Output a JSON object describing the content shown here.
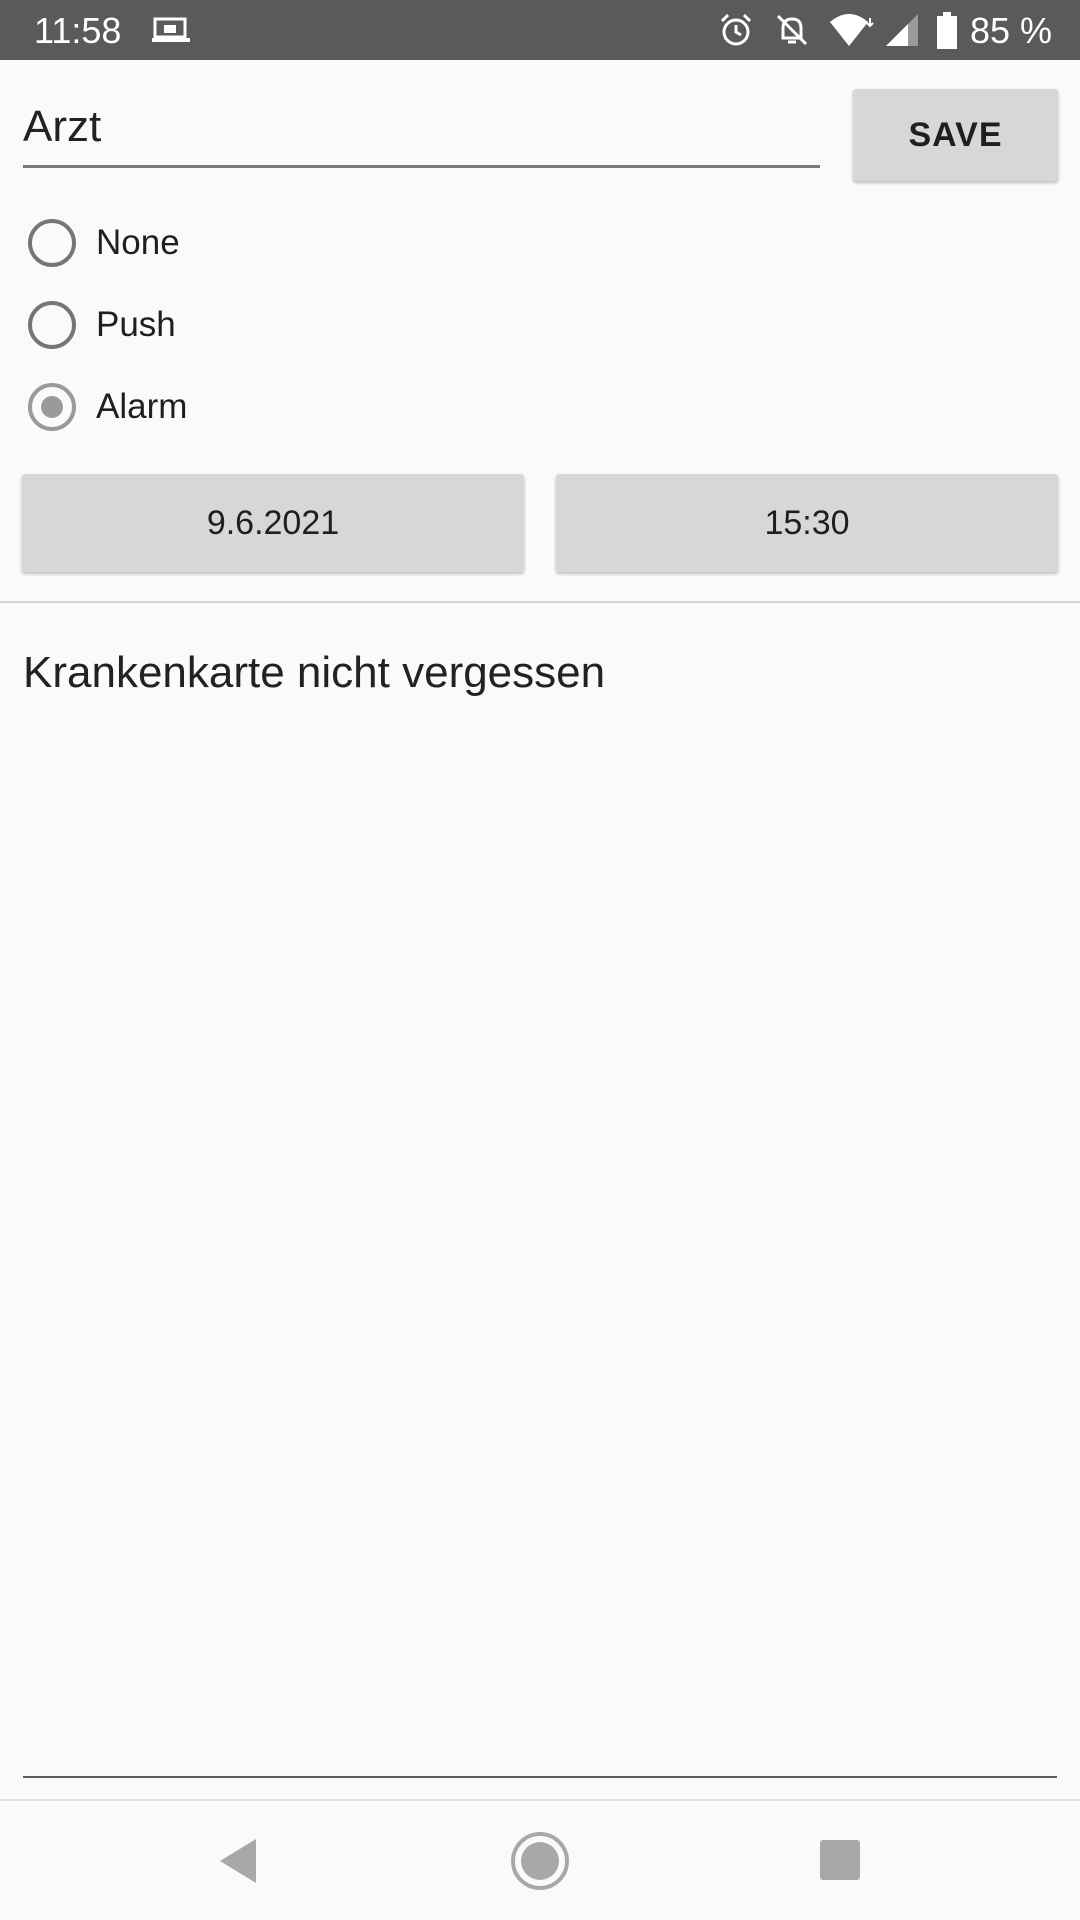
{
  "status_bar": {
    "time": "11:58",
    "battery_percent": "85 %",
    "icons": [
      "cast-icon",
      "alarm-clock-icon",
      "notifications-off-icon",
      "wifi-icon",
      "cell-signal-icon",
      "battery-icon"
    ]
  },
  "form": {
    "title_value": "Arzt",
    "save_label": "SAVE",
    "radio_options": [
      {
        "label": "None",
        "checked": false
      },
      {
        "label": "Push",
        "checked": false
      },
      {
        "label": "Alarm",
        "checked": true
      }
    ],
    "date_label": "9.6.2021",
    "time_label": "15:30",
    "note_value": "Krankenkarte nicht vergessen"
  },
  "nav_bar": {
    "icons": [
      "back-icon",
      "home-icon",
      "recents-icon"
    ]
  },
  "colors": {
    "status_bar_bg": "#5a5a5a",
    "background": "#fafafa",
    "button_bg": "#d6d7d7",
    "radio_checked": "#9a9a9a"
  }
}
